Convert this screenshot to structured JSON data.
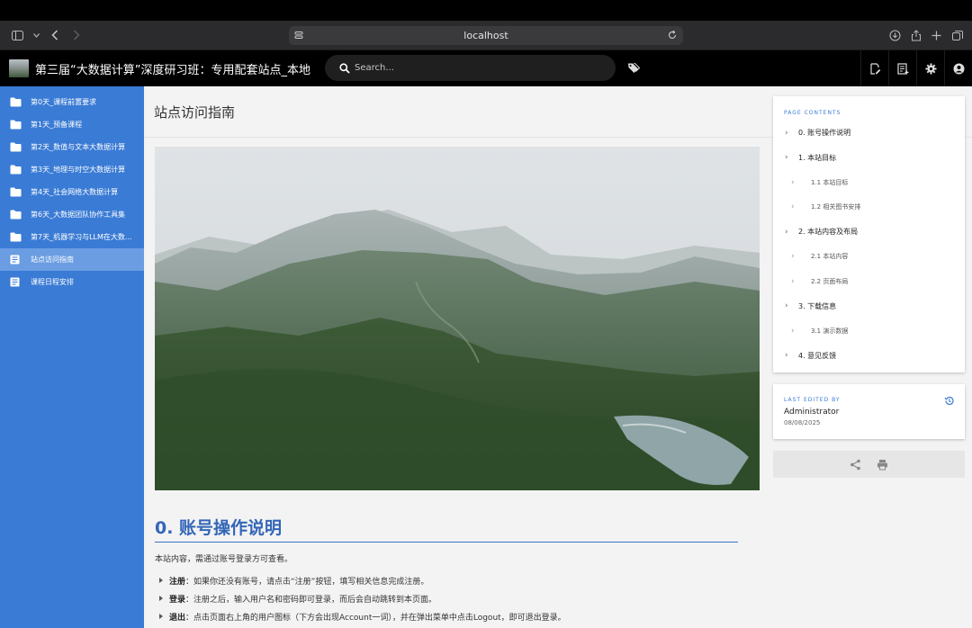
{
  "browser": {
    "url": "localhost"
  },
  "header": {
    "site_title": "第三届“大数据计算”深度研习班：专用配套站点_本地",
    "search_placeholder": "Search..."
  },
  "sidebar": {
    "items": [
      {
        "label": "第0天_课程前置要求",
        "icon": "folder-icon"
      },
      {
        "label": "第1天_预备课程",
        "icon": "folder-icon"
      },
      {
        "label": "第2天_数值与文本大数据计算",
        "icon": "folder-icon"
      },
      {
        "label": "第3天_地理与时空大数据计算",
        "icon": "folder-icon"
      },
      {
        "label": "第4天_社会网络大数据计算",
        "icon": "folder-icon"
      },
      {
        "label": "第6天_大数据团队协作工具集",
        "icon": "folder-icon"
      },
      {
        "label": "第7天_机器学习与LLM在大数...",
        "icon": "folder-icon"
      },
      {
        "label": "站点访问指南",
        "icon": "page-icon",
        "active": true
      },
      {
        "label": "课程日程安排",
        "icon": "page-icon"
      }
    ]
  },
  "page": {
    "title": "站点访问指南",
    "section_heading": "0. 账号操作说明",
    "intro": "本站内容，需通过账号登录方可查看。",
    "bullets": [
      {
        "term": "注册",
        "text": "：如果你还没有账号，请点击“注册”按钮，填写相关信息完成注册。"
      },
      {
        "term": "登录",
        "text": "：注册之后，输入用户名和密码即可登录，而后会自动跳转到本页面。"
      },
      {
        "term": "退出",
        "text": "：点击页面右上角的用户图标（下方会出现Account一词），并在弹出菜单中点击Logout，即可退出登录。"
      }
    ]
  },
  "toc": {
    "heading": "PAGE CONTENTS",
    "items": [
      {
        "label": "0. 账号操作说明",
        "level": 1
      },
      {
        "label": "1. 本站目标",
        "level": 1
      },
      {
        "label": "1.1 本站目标",
        "level": 2
      },
      {
        "label": "1.2 相关图书安排",
        "level": 2
      },
      {
        "label": "2. 本站内容及布局",
        "level": 1
      },
      {
        "label": "2.1 本站内容",
        "level": 2
      },
      {
        "label": "2.2 页面布局",
        "level": 2
      },
      {
        "label": "3. 下载信息",
        "level": 1
      },
      {
        "label": "3.1 演示数据",
        "level": 2
      },
      {
        "label": "4. 意见反馈",
        "level": 1
      }
    ]
  },
  "last_edited": {
    "label": "LAST EDITED BY",
    "user": "Administrator",
    "date": "08/08/2025"
  },
  "colors": {
    "sidebar": "#3a7bd5",
    "sidebar_active": "#6a9de2",
    "heading": "#3366b8",
    "accent": "#3a7bd5"
  }
}
